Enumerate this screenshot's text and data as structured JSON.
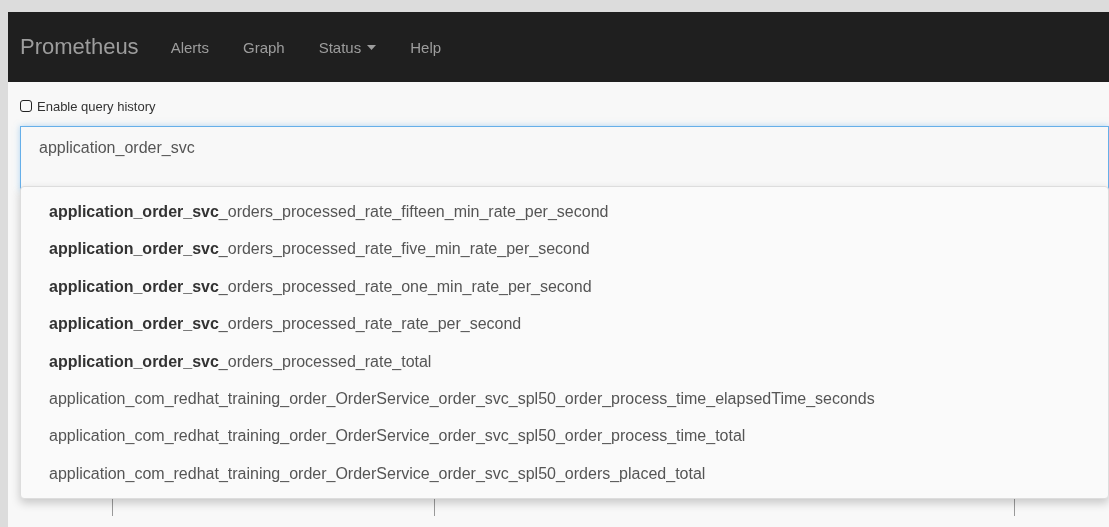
{
  "navbar": {
    "brand": "Prometheus",
    "items": [
      {
        "label": "Alerts",
        "dropdown": false
      },
      {
        "label": "Graph",
        "dropdown": false
      },
      {
        "label": "Status",
        "dropdown": true
      },
      {
        "label": "Help",
        "dropdown": false
      }
    ]
  },
  "query_history": {
    "label": "Enable query history",
    "checked": false
  },
  "expression": {
    "value": "application_order_svc"
  },
  "suggestions": [
    {
      "text": "**application_order_svc**_orders_processed_rate_fifteen_min_rate_per_second"
    },
    {
      "text": "**application_order_svc**_orders_processed_rate_five_min_rate_per_second"
    },
    {
      "text": "**application_order_svc**_orders_processed_rate_one_min_rate_per_second"
    },
    {
      "text": "**application_order_svc**_orders_processed_rate_rate_per_second"
    },
    {
      "text": "**application_order_svc**_orders_processed_rate_total"
    },
    {
      "text": "application_com_redhat_training_order_OrderService_order_svc_spl50_order_process_time_elapsedTime_seconds"
    },
    {
      "text": "application_com_redhat_training_order_OrderService_order_svc_spl50_order_process_time_total"
    },
    {
      "text": "application_com_redhat_training_order_OrderService_order_svc_spl50_orders_placed_total"
    }
  ]
}
